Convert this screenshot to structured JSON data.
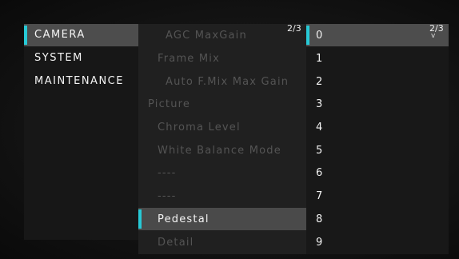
{
  "menu_level1": {
    "items": [
      {
        "label": "CAMERA",
        "selected": true
      },
      {
        "label": "SYSTEM",
        "selected": false
      },
      {
        "label": "MAINTENANCE",
        "selected": false
      }
    ]
  },
  "menu_level2": {
    "page_indicator": "2/3",
    "items": [
      {
        "label": "AGC MaxGain",
        "level": 2,
        "enabled": false,
        "selected": false
      },
      {
        "label": "Frame Mix",
        "level": 1,
        "enabled": false,
        "selected": false
      },
      {
        "label": "Auto F.Mix Max Gain",
        "level": 2,
        "enabled": false,
        "selected": false
      },
      {
        "label": "Picture",
        "level": 0,
        "enabled": false,
        "selected": false
      },
      {
        "label": "Chroma Level",
        "level": 1,
        "enabled": false,
        "selected": false
      },
      {
        "label": "White Balance Mode",
        "level": 1,
        "enabled": false,
        "selected": false
      },
      {
        "label": "----",
        "level": 1,
        "enabled": false,
        "selected": false
      },
      {
        "label": "----",
        "level": 1,
        "enabled": false,
        "selected": false
      },
      {
        "label": "Pedestal",
        "level": 1,
        "enabled": true,
        "selected": true
      },
      {
        "label": "Detail",
        "level": 1,
        "enabled": false,
        "selected": false
      }
    ]
  },
  "menu_level3": {
    "page_indicator": "2/3",
    "more_indicator": "v",
    "items": [
      {
        "label": "0",
        "selected": true
      },
      {
        "label": "1",
        "selected": false
      },
      {
        "label": "2",
        "selected": false
      },
      {
        "label": "3",
        "selected": false
      },
      {
        "label": "4",
        "selected": false
      },
      {
        "label": "5",
        "selected": false
      },
      {
        "label": "6",
        "selected": false
      },
      {
        "label": "7",
        "selected": false
      },
      {
        "label": "8",
        "selected": false
      },
      {
        "label": "9",
        "selected": false
      }
    ]
  },
  "colors": {
    "accent": "#27c9d6",
    "selected_background": "#4d4d4d",
    "disabled_text": "#545454",
    "text": "#f4f4f4"
  }
}
